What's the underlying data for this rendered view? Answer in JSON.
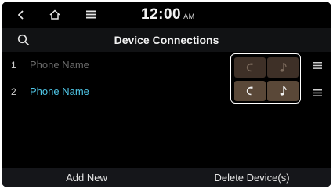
{
  "status": {
    "time": "12:00",
    "ampm": "AM",
    "icons": [
      "back-icon",
      "home-icon",
      "menu-icon"
    ]
  },
  "header": {
    "title": "Device Connections",
    "search_icon": "search-icon"
  },
  "devices": [
    {
      "index": "1",
      "name": "Phone Name",
      "state": "disconnected",
      "profiles": [
        {
          "name": "phone-profile",
          "icon": "handset-icon",
          "on": false
        },
        {
          "name": "audio-profile",
          "icon": "music-note-icon",
          "on": false
        }
      ]
    },
    {
      "index": "2",
      "name": "Phone Name",
      "state": "connected",
      "profiles": [
        {
          "name": "phone-profile",
          "icon": "handset-icon",
          "on": true
        },
        {
          "name": "audio-profile",
          "icon": "music-note-icon",
          "on": true
        }
      ]
    }
  ],
  "footer": {
    "add_label": "Add New",
    "delete_label": "Delete Device(s)"
  },
  "colors": {
    "accent": "#4fc6e6",
    "profile_button": "#5a4838",
    "background": "#000000"
  }
}
